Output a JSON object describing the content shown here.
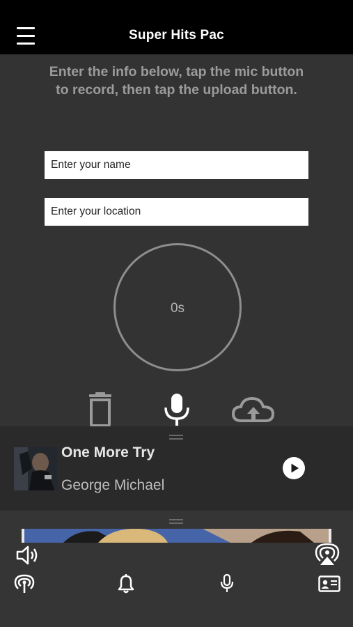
{
  "header": {
    "title": "Super Hits Pac",
    "menu_icon": "hamburger-menu-icon"
  },
  "instructions": "Enter the info below, tap the mic button to record, then tap the upload button.",
  "form": {
    "name_placeholder": "Enter your name",
    "location_placeholder": "Enter your location"
  },
  "recorder": {
    "timer_text": "0s",
    "icons": [
      "trash-icon",
      "microphone-icon",
      "cloud-upload-icon"
    ]
  },
  "now_playing": {
    "title": "One More Try",
    "artist": "George Michael",
    "play_icon": "play-icon"
  },
  "bottom_bar": {
    "icons": [
      "volume-icon",
      "airplay-icon",
      "radio-broadcast-icon",
      "bell-icon",
      "microphone-icon",
      "contact-card-icon"
    ]
  },
  "colors": {
    "background": "#333333",
    "header_background": "#000000",
    "panel_background": "#2a2a2a",
    "accent_text": "#9b9b9b"
  }
}
